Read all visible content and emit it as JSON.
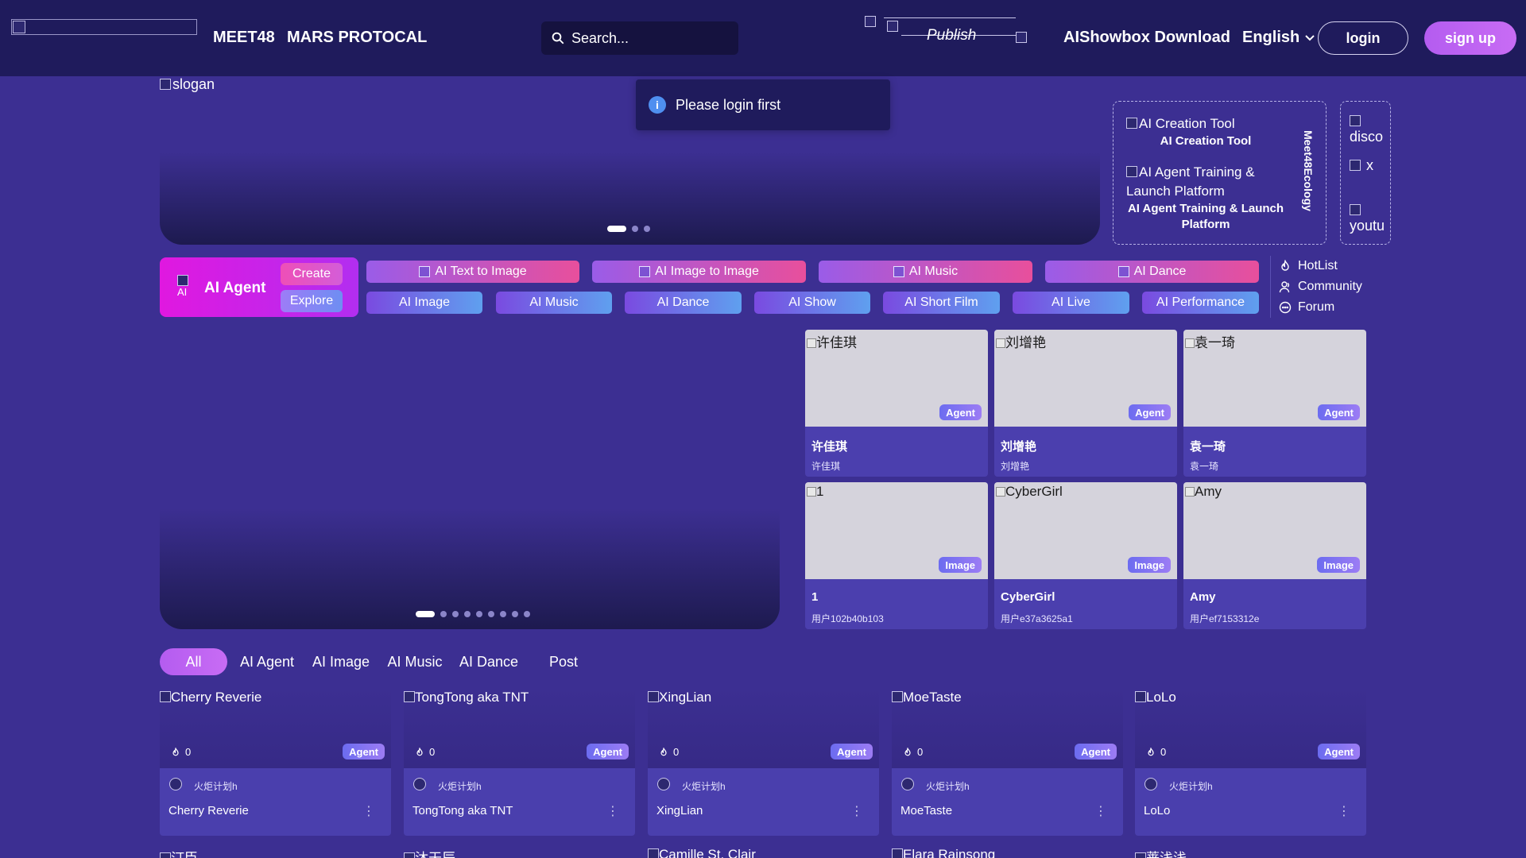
{
  "header": {
    "nav": [
      "MEET48",
      "MARS PROTOCAL"
    ],
    "search_placeholder": "Search...",
    "publish": "Publish",
    "download": "AIShowbox Download",
    "language": "English",
    "login": "login",
    "signup": "sign up"
  },
  "banner": {
    "slogan_alt": "slogan",
    "dots_total": 3,
    "dots_active": 1
  },
  "toast": {
    "message": "Please login first"
  },
  "ecology": {
    "vertical_label": "Meet48Ecology",
    "items": [
      {
        "alt": "AI Creation Tool",
        "caption": "AI Creation Tool"
      },
      {
        "alt": "AI Agent Training & Launch Platform",
        "caption": "AI Agent Training & Launch Platform"
      }
    ]
  },
  "social": [
    "disco",
    "x",
    "youtu"
  ],
  "agent_card": {
    "icon_alt": "AI",
    "title": "AI Agent",
    "create": "Create",
    "explore": "Explore"
  },
  "categories_top": [
    "AI Text to Image",
    "AI Image to Image",
    "AI Music",
    "AI Dance"
  ],
  "categories_bottom": [
    "AI Image",
    "AI Music",
    "AI Dance",
    "AI Show",
    "AI Short Film",
    "AI Live",
    "AI Performance"
  ],
  "side_links": [
    "HotList",
    "Community",
    "Forum"
  ],
  "hero": {
    "dots_total": 9,
    "dots_active": 1
  },
  "featured": [
    {
      "alt": "许佳琪",
      "badge": "Agent",
      "name": "许佳琪",
      "sub": "许佳琪"
    },
    {
      "alt": "刘增艳",
      "badge": "Agent",
      "name": "刘增艳",
      "sub": "刘增艳"
    },
    {
      "alt": "袁一琦",
      "badge": "Agent",
      "name": "袁一琦",
      "sub": "袁一琦"
    },
    {
      "alt": "1",
      "badge": "Image",
      "name": "1",
      "sub": "用户102b40b103"
    },
    {
      "alt": "CyberGirl",
      "badge": "Image",
      "name": "CyberGirl",
      "sub": "用户e37a3625a1"
    },
    {
      "alt": "Amy",
      "badge": "Image",
      "name": "Amy",
      "sub": "用户ef7153312e"
    }
  ],
  "tabs": [
    "All",
    "AI Agent",
    "AI Image",
    "AI Music",
    "AI Dance",
    "Post"
  ],
  "cards": [
    {
      "alt": "Cherry Reverie",
      "likes": "0",
      "badge": "Agent",
      "author": "火炬计划h",
      "title": "Cherry Reverie"
    },
    {
      "alt": "TongTong aka TNT",
      "likes": "0",
      "badge": "Agent",
      "author": "火炬计划h",
      "title": "TongTong aka TNT"
    },
    {
      "alt": "XingLian",
      "likes": "0",
      "badge": "Agent",
      "author": "火炬计划h",
      "title": "XingLian"
    },
    {
      "alt": "MoeTaste",
      "likes": "0",
      "badge": "Agent",
      "author": "火炬计划h",
      "title": "MoeTaste"
    },
    {
      "alt": "LoLo",
      "likes": "0",
      "badge": "Agent",
      "author": "火炬计划h",
      "title": "LoLo"
    }
  ],
  "next_row_peek": [
    "汀臣",
    "沐天辰",
    "Camille St. Clair",
    "Elara Rainsong",
    "蔷浅浅"
  ]
}
